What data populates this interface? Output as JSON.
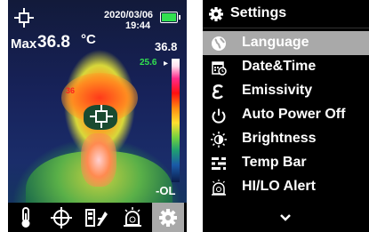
{
  "camera": {
    "date": "2020/03/06",
    "time": "19:44",
    "max_label": "Max",
    "max_value": "36.8",
    "max_unit": "°C",
    "scale_max": "36.8",
    "scale_current": "25.6",
    "scale_min": "-OL",
    "spot_temp": "36",
    "battery_color": "#32e050",
    "toolbar": [
      {
        "icon": "thermometer-icon"
      },
      {
        "icon": "crosshair-icon"
      },
      {
        "icon": "image-mode-icon"
      },
      {
        "icon": "alarm-bell-icon"
      },
      {
        "icon": "gear-icon",
        "selected": true
      }
    ]
  },
  "settings": {
    "title": "Settings",
    "items": [
      {
        "label": "Language",
        "icon": "globe-icon",
        "selected": true
      },
      {
        "label": "Date&Time",
        "icon": "calendar-clock-icon"
      },
      {
        "label": "Emissivity",
        "icon": "epsilon-icon"
      },
      {
        "label": "Auto Power Off",
        "icon": "power-icon"
      },
      {
        "label": "Brightness",
        "icon": "brightness-icon"
      },
      {
        "label": "Temp Bar",
        "icon": "temp-bar-icon"
      },
      {
        "label": "HI/LO Alert",
        "icon": "alert-bell-icon"
      }
    ],
    "more_indicator": "chevron-down-icon",
    "selected_color": "#a9a9a9"
  }
}
